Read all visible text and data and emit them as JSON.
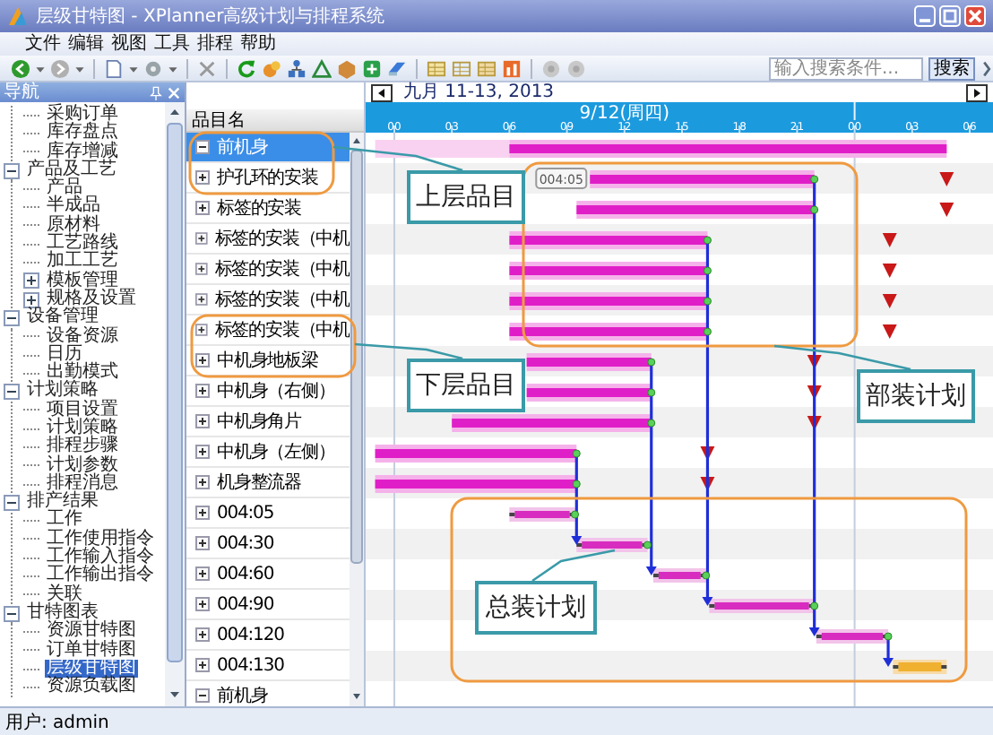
{
  "window": {
    "title": "层级甘特图 - XPlanner高级计划与排程系统"
  },
  "menu": [
    "文件",
    "编辑",
    "视图",
    "工具",
    "排程",
    "帮助"
  ],
  "toolbar": {
    "search": {
      "placeholder": "输入搜索条件..."
    },
    "search_button": "搜索"
  },
  "navigator": {
    "title": "导航",
    "items": [
      {
        "children": [
          {
            "label": "采购订单",
            "selected": false
          },
          {
            "label": "库存盘点",
            "selected": false
          },
          {
            "label": "库存增减",
            "selected": false
          }
        ]
      },
      {
        "label": "产品及工艺",
        "expanded": true,
        "selected": false,
        "children": [
          {
            "label": "产品",
            "selected": false
          },
          {
            "label": "半成品",
            "selected": false
          },
          {
            "label": "原材料",
            "selected": false
          },
          {
            "label": "工艺路线",
            "selected": false
          },
          {
            "label": "加工工艺",
            "selected": false
          },
          {
            "label": "模板管理",
            "expanded": false,
            "selected": false
          },
          {
            "label": "规格及设置",
            "expanded": false,
            "selected": false
          }
        ]
      },
      {
        "label": "设备管理",
        "expanded": true,
        "selected": false,
        "children": [
          {
            "label": "设备资源",
            "selected": false
          },
          {
            "label": "日历",
            "selected": false
          },
          {
            "label": "出勤模式",
            "selected": false
          }
        ]
      },
      {
        "label": "计划策略",
        "expanded": true,
        "selected": false,
        "children": [
          {
            "label": "项目设置",
            "selected": false
          },
          {
            "label": "计划策略",
            "selected": false
          },
          {
            "label": "排程步骤",
            "selected": false
          },
          {
            "label": "计划参数",
            "selected": false
          },
          {
            "label": "排程消息",
            "selected": false
          }
        ]
      },
      {
        "label": "排产结果",
        "expanded": true,
        "selected": false,
        "children": [
          {
            "label": "工作",
            "selected": false
          },
          {
            "label": "工作使用指令",
            "selected": false
          },
          {
            "label": "工作输入指令",
            "selected": false
          },
          {
            "label": "工作输出指令",
            "selected": false
          },
          {
            "label": "关联",
            "selected": false
          }
        ]
      },
      {
        "label": "甘特图表",
        "expanded": true,
        "selected": false,
        "children": [
          {
            "label": "资源甘特图",
            "selected": false
          },
          {
            "label": "订单甘特图",
            "selected": false
          },
          {
            "label": "层级甘特图",
            "selected": true
          },
          {
            "label": "资源负载图",
            "selected": false
          }
        ]
      }
    ]
  },
  "date_nav": {
    "label": "九月 11-13, 2013"
  },
  "timeline": {
    "day": "9/12(周四)",
    "hours": [
      "00",
      "03",
      "06",
      "09",
      "12",
      "15",
      "18",
      "21",
      "00",
      "03",
      "06"
    ]
  },
  "list": {
    "header": "品目名"
  },
  "rows": [
    {
      "name": "前机身",
      "selected": true,
      "expanded": true,
      "milestone": false,
      "bar": {
        "kind": "task"
      }
    },
    {
      "name": "护孔环的安装",
      "selected": false,
      "expanded": false,
      "milestone": true,
      "bar": {
        "kind": "task",
        "tooltip": "004:05"
      }
    },
    {
      "name": "标签的安装",
      "selected": false,
      "expanded": false,
      "milestone": true,
      "bar": {
        "kind": "task"
      }
    },
    {
      "name": "标签的安装（中机",
      "selected": false,
      "expanded": false,
      "milestone": true,
      "bar": {
        "kind": "task"
      }
    },
    {
      "name": "标签的安装（中机",
      "selected": false,
      "expanded": false,
      "milestone": true,
      "bar": {
        "kind": "task"
      }
    },
    {
      "name": "标签的安装（中机",
      "selected": false,
      "expanded": false,
      "milestone": true,
      "bar": {
        "kind": "task"
      }
    },
    {
      "name": "标签的安装（中机",
      "selected": false,
      "expanded": false,
      "milestone": true,
      "bar": {
        "kind": "task"
      }
    },
    {
      "name": "中机身地板梁",
      "selected": false,
      "expanded": false,
      "milestone": true,
      "bar": {
        "kind": "task"
      }
    },
    {
      "name": "中机身（右侧）",
      "selected": false,
      "expanded": false,
      "milestone": true,
      "bar": {
        "kind": "task"
      }
    },
    {
      "name": "中机身角片",
      "selected": false,
      "expanded": false,
      "milestone": true,
      "bar": {
        "kind": "task"
      }
    },
    {
      "name": "中机身（左侧）",
      "selected": false,
      "expanded": false,
      "milestone": true,
      "bar": {
        "kind": "task"
      }
    },
    {
      "name": "机身整流器",
      "selected": false,
      "expanded": false,
      "milestone": true,
      "bar": {
        "kind": "task"
      }
    },
    {
      "name": "004:05",
      "selected": false,
      "expanded": false,
      "milestone": false,
      "bar": {
        "kind": "assembly"
      }
    },
    {
      "name": "004:30",
      "selected": false,
      "expanded": false,
      "milestone": false,
      "bar": {
        "kind": "assembly"
      }
    },
    {
      "name": "004:60",
      "selected": false,
      "expanded": false,
      "milestone": false,
      "bar": {
        "kind": "assembly"
      }
    },
    {
      "name": "004:90",
      "selected": false,
      "expanded": false,
      "milestone": false,
      "bar": {
        "kind": "assembly"
      }
    },
    {
      "name": "004:120",
      "selected": false,
      "expanded": false,
      "milestone": false,
      "bar": {
        "kind": "assembly"
      }
    },
    {
      "name": "004:130",
      "selected": false,
      "expanded": false,
      "milestone": false,
      "bar": {
        "kind": "final"
      }
    },
    {
      "name": "前机身",
      "selected": false,
      "expanded": true,
      "milestone": false
    }
  ],
  "annotations": [
    {
      "text": "上层品目"
    },
    {
      "text": "下层品目"
    },
    {
      "text": "部装计划"
    },
    {
      "text": "总装计划"
    }
  ],
  "status_bar": {
    "user": "用户: admin"
  }
}
